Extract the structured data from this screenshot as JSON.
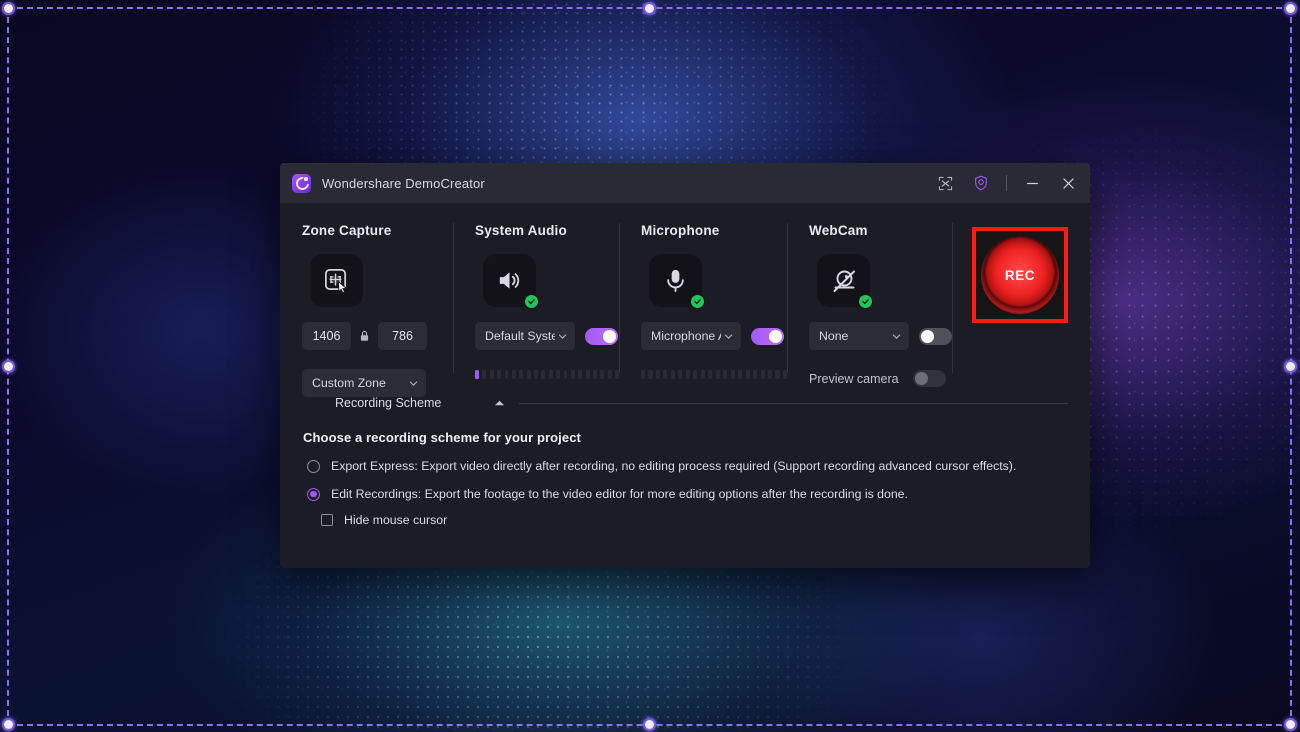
{
  "window": {
    "app_title": "Wondershare DemoCreator",
    "logo_icon": "democreator-logo-icon",
    "title_actions": [
      {
        "name": "screenshot-capture-icon",
        "label": "Screenshot"
      },
      {
        "name": "rewards-shield-icon",
        "label": "Rewards"
      },
      {
        "name": "minimize-icon",
        "label": "Minimize"
      },
      {
        "name": "close-icon",
        "label": "Close"
      }
    ]
  },
  "columns": {
    "zone_capture": {
      "title": "Zone Capture",
      "icon": "zone-capture-icon",
      "width_value": "1406",
      "height_value": "786",
      "lock_icon": "aspect-lock-icon",
      "zone_select": "Custom Zone"
    },
    "system_audio": {
      "title": "System Audio",
      "icon": "speaker-icon",
      "status_badge": "enabled-check-icon",
      "device_select": "Default Syste",
      "toggle_state": "on",
      "meter_segments": 20,
      "meter_active": 1
    },
    "microphone": {
      "title": "Microphone",
      "icon": "microphone-icon",
      "status_badge": "enabled-check-icon",
      "device_select": "Microphone A",
      "toggle_state": "on",
      "meter_segments": 20,
      "meter_active": 0
    },
    "webcam": {
      "title": "WebCam",
      "icon": "webcam-disabled-icon",
      "status_badge": "enabled-check-icon",
      "device_select": "None",
      "toggle_state": "off",
      "preview_label": "Preview camera",
      "preview_toggle_state": "disabled"
    },
    "record": {
      "label": "REC",
      "accent_color": "#ff1a1a",
      "highlighted": true
    }
  },
  "scheme": {
    "section_title": "Recording Scheme",
    "collapse_icon": "chevron-up-icon",
    "heading": "Choose a recording scheme for your project",
    "options": [
      {
        "id": "export-express",
        "label": "Export Express: Export video directly after recording, no editing process required (Support recording advanced cursor effects).",
        "selected": false
      },
      {
        "id": "edit-recordings",
        "label": "Edit Recordings: Export the footage to the video editor for more editing options after the recording is done.",
        "selected": true
      }
    ],
    "hide_cursor": {
      "label": "Hide mouse cursor",
      "checked": false
    }
  },
  "capture_overlay": {
    "name": "capture-selection-region",
    "border_color": "#8b6ff0",
    "handle_count": 8
  }
}
